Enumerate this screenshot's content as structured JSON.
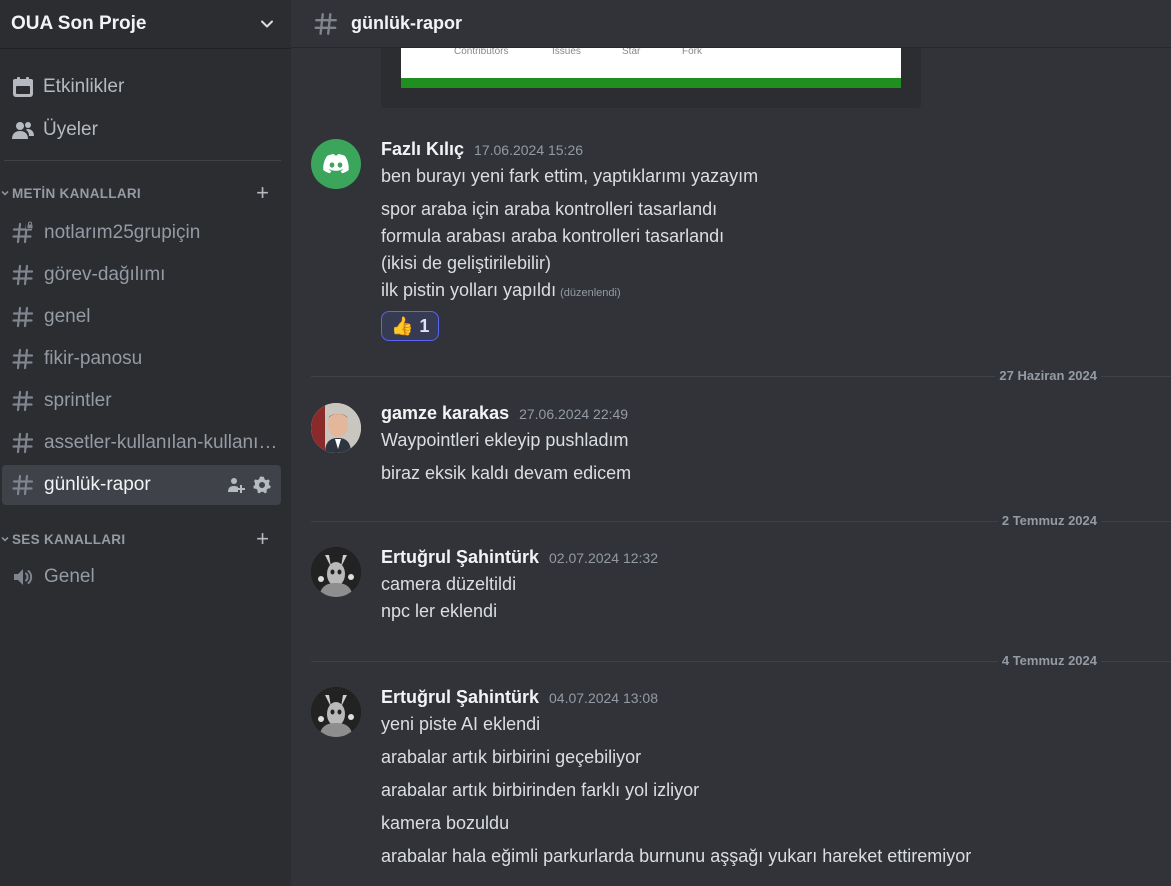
{
  "sidebar": {
    "server_name": "OUA Son Proje",
    "nav": [
      {
        "label": "Etkinlikler",
        "icon": "calendar-icon"
      },
      {
        "label": "Üyeler",
        "icon": "members-icon"
      }
    ],
    "text_category": "METİN KANALLARI",
    "voice_category": "SES KANALLARI",
    "text_channels": [
      {
        "name": "notlarım25grupiçin"
      },
      {
        "name": "görev-dağılımı"
      },
      {
        "name": "genel"
      },
      {
        "name": "fikir-panosu"
      },
      {
        "name": "sprintler"
      },
      {
        "name": "assetler-kullanılan-kullanılabilecek"
      },
      {
        "name": "günlük-rapor"
      }
    ],
    "voice_channels": [
      {
        "name": "Genel"
      }
    ]
  },
  "channel": {
    "title": "günlük-rapor"
  },
  "embed": {
    "labels": [
      "Contributors",
      "Issues",
      "Star",
      "Fork"
    ]
  },
  "messages": [
    {
      "author": "Fazlı Kılıç",
      "time": "17.06.2024 15:26",
      "lines": [
        "ben burayı yeni fark ettim, yaptıklarımı yazayım",
        "spor araba için araba kontrolleri tasarlandı",
        "formula arabası araba kontrolleri tasarlandı",
        "(ikisi de geliştirilebilir)",
        "ilk pistin yolları yapıldı"
      ],
      "edited": "(düzenlendi)",
      "reaction": {
        "emoji": "👍",
        "count": "1"
      }
    },
    {
      "date": "27 Haziran 2024",
      "author": "gamze karakas",
      "time": "27.06.2024 22:49",
      "lines": [
        "Waypointleri ekleyip pushladım",
        "biraz eksik kaldı devam edicem"
      ]
    },
    {
      "date": "2 Temmuz 2024",
      "author": "Ertuğrul Şahintürk",
      "time": "02.07.2024 12:32",
      "lines": [
        "camera düzeltildi",
        "npc ler eklendi"
      ]
    },
    {
      "date": "4 Temmuz 2024",
      "author": "Ertuğrul Şahintürk",
      "time": "04.07.2024 13:08",
      "lines": [
        "yeni piste AI eklendi",
        "arabalar artık birbirini geçebiliyor",
        "arabalar artık birbirinden farklı yol izliyor",
        "kamera bozuldu",
        "arabalar hala eğimli parkurlarda burnunu aşşağı yukarı hareket ettiremiyor"
      ]
    }
  ],
  "colors": {
    "accent": "#5865f2",
    "discord_green": "#3ba55c",
    "embed_bar": "#1f8f1f"
  }
}
